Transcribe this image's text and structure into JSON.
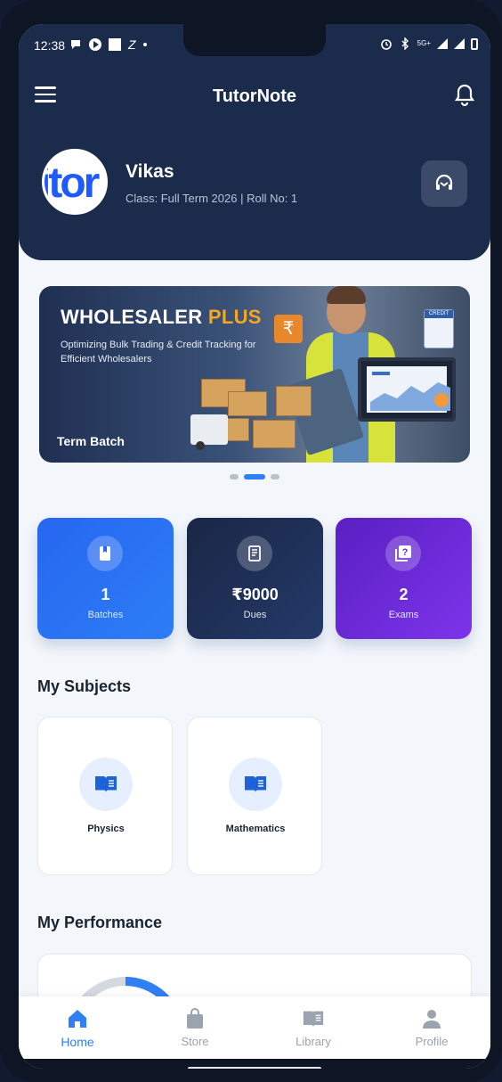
{
  "status_bar": {
    "time": "12:38",
    "left_extra": "Z",
    "right_network": "5G+"
  },
  "header": {
    "title": "TutorNote"
  },
  "profile": {
    "avatar_text": "itor",
    "name": "Vikas",
    "meta": "Class: Full Term 2026  |  Roll No: 1"
  },
  "banner": {
    "title_main": "WHOLESALER ",
    "title_accent": "PLUS",
    "subtitle": "Optimizing Bulk Trading & Credit Tracking for Efficient Wholesalers",
    "credit_label": "CREDIT",
    "rupee_symbol": "₹",
    "label": "Term Batch",
    "active_slide": 2,
    "total_slides": 3
  },
  "stats": [
    {
      "value": "1",
      "label": "Batches",
      "icon": "book-icon"
    },
    {
      "value": "₹9000",
      "label": "Dues",
      "icon": "receipt-icon"
    },
    {
      "value": "2",
      "label": "Exams",
      "icon": "question-book-icon"
    }
  ],
  "subjects": {
    "title": "My Subjects",
    "items": [
      {
        "name": "Physics",
        "icon": "open-book-icon"
      },
      {
        "name": "Mathematics",
        "icon": "open-book-icon"
      }
    ]
  },
  "performance": {
    "title": "My Performance"
  },
  "bottom_nav": [
    {
      "label": "Home",
      "icon": "home-icon",
      "active": true
    },
    {
      "label": "Store",
      "icon": "bag-icon",
      "active": false
    },
    {
      "label": "Library",
      "icon": "library-icon",
      "active": false
    },
    {
      "label": "Profile",
      "icon": "person-icon",
      "active": false
    }
  ],
  "colors": {
    "header_bg": "#1a2b4c",
    "accent_blue": "#2f7ff5",
    "dues_card": "#1a2646",
    "exams_card": "#6a28d8",
    "banner_accent": "#f5a623"
  }
}
